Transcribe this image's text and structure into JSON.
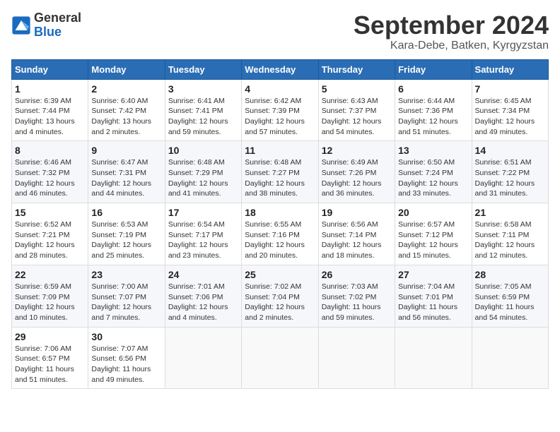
{
  "header": {
    "logo_general": "General",
    "logo_blue": "Blue",
    "month_title": "September 2024",
    "location": "Kara-Debe, Batken, Kyrgyzstan"
  },
  "weekdays": [
    "Sunday",
    "Monday",
    "Tuesday",
    "Wednesday",
    "Thursday",
    "Friday",
    "Saturday"
  ],
  "weeks": [
    [
      {
        "day": "1",
        "info": "Sunrise: 6:39 AM\nSunset: 7:44 PM\nDaylight: 13 hours and 4 minutes."
      },
      {
        "day": "2",
        "info": "Sunrise: 6:40 AM\nSunset: 7:42 PM\nDaylight: 13 hours and 2 minutes."
      },
      {
        "day": "3",
        "info": "Sunrise: 6:41 AM\nSunset: 7:41 PM\nDaylight: 12 hours and 59 minutes."
      },
      {
        "day": "4",
        "info": "Sunrise: 6:42 AM\nSunset: 7:39 PM\nDaylight: 12 hours and 57 minutes."
      },
      {
        "day": "5",
        "info": "Sunrise: 6:43 AM\nSunset: 7:37 PM\nDaylight: 12 hours and 54 minutes."
      },
      {
        "day": "6",
        "info": "Sunrise: 6:44 AM\nSunset: 7:36 PM\nDaylight: 12 hours and 51 minutes."
      },
      {
        "day": "7",
        "info": "Sunrise: 6:45 AM\nSunset: 7:34 PM\nDaylight: 12 hours and 49 minutes."
      }
    ],
    [
      {
        "day": "8",
        "info": "Sunrise: 6:46 AM\nSunset: 7:32 PM\nDaylight: 12 hours and 46 minutes."
      },
      {
        "day": "9",
        "info": "Sunrise: 6:47 AM\nSunset: 7:31 PM\nDaylight: 12 hours and 44 minutes."
      },
      {
        "day": "10",
        "info": "Sunrise: 6:48 AM\nSunset: 7:29 PM\nDaylight: 12 hours and 41 minutes."
      },
      {
        "day": "11",
        "info": "Sunrise: 6:48 AM\nSunset: 7:27 PM\nDaylight: 12 hours and 38 minutes."
      },
      {
        "day": "12",
        "info": "Sunrise: 6:49 AM\nSunset: 7:26 PM\nDaylight: 12 hours and 36 minutes."
      },
      {
        "day": "13",
        "info": "Sunrise: 6:50 AM\nSunset: 7:24 PM\nDaylight: 12 hours and 33 minutes."
      },
      {
        "day": "14",
        "info": "Sunrise: 6:51 AM\nSunset: 7:22 PM\nDaylight: 12 hours and 31 minutes."
      }
    ],
    [
      {
        "day": "15",
        "info": "Sunrise: 6:52 AM\nSunset: 7:21 PM\nDaylight: 12 hours and 28 minutes."
      },
      {
        "day": "16",
        "info": "Sunrise: 6:53 AM\nSunset: 7:19 PM\nDaylight: 12 hours and 25 minutes."
      },
      {
        "day": "17",
        "info": "Sunrise: 6:54 AM\nSunset: 7:17 PM\nDaylight: 12 hours and 23 minutes."
      },
      {
        "day": "18",
        "info": "Sunrise: 6:55 AM\nSunset: 7:16 PM\nDaylight: 12 hours and 20 minutes."
      },
      {
        "day": "19",
        "info": "Sunrise: 6:56 AM\nSunset: 7:14 PM\nDaylight: 12 hours and 18 minutes."
      },
      {
        "day": "20",
        "info": "Sunrise: 6:57 AM\nSunset: 7:12 PM\nDaylight: 12 hours and 15 minutes."
      },
      {
        "day": "21",
        "info": "Sunrise: 6:58 AM\nSunset: 7:11 PM\nDaylight: 12 hours and 12 minutes."
      }
    ],
    [
      {
        "day": "22",
        "info": "Sunrise: 6:59 AM\nSunset: 7:09 PM\nDaylight: 12 hours and 10 minutes."
      },
      {
        "day": "23",
        "info": "Sunrise: 7:00 AM\nSunset: 7:07 PM\nDaylight: 12 hours and 7 minutes."
      },
      {
        "day": "24",
        "info": "Sunrise: 7:01 AM\nSunset: 7:06 PM\nDaylight: 12 hours and 4 minutes."
      },
      {
        "day": "25",
        "info": "Sunrise: 7:02 AM\nSunset: 7:04 PM\nDaylight: 12 hours and 2 minutes."
      },
      {
        "day": "26",
        "info": "Sunrise: 7:03 AM\nSunset: 7:02 PM\nDaylight: 11 hours and 59 minutes."
      },
      {
        "day": "27",
        "info": "Sunrise: 7:04 AM\nSunset: 7:01 PM\nDaylight: 11 hours and 56 minutes."
      },
      {
        "day": "28",
        "info": "Sunrise: 7:05 AM\nSunset: 6:59 PM\nDaylight: 11 hours and 54 minutes."
      }
    ],
    [
      {
        "day": "29",
        "info": "Sunrise: 7:06 AM\nSunset: 6:57 PM\nDaylight: 11 hours and 51 minutes."
      },
      {
        "day": "30",
        "info": "Sunrise: 7:07 AM\nSunset: 6:56 PM\nDaylight: 11 hours and 49 minutes."
      },
      null,
      null,
      null,
      null,
      null
    ]
  ]
}
